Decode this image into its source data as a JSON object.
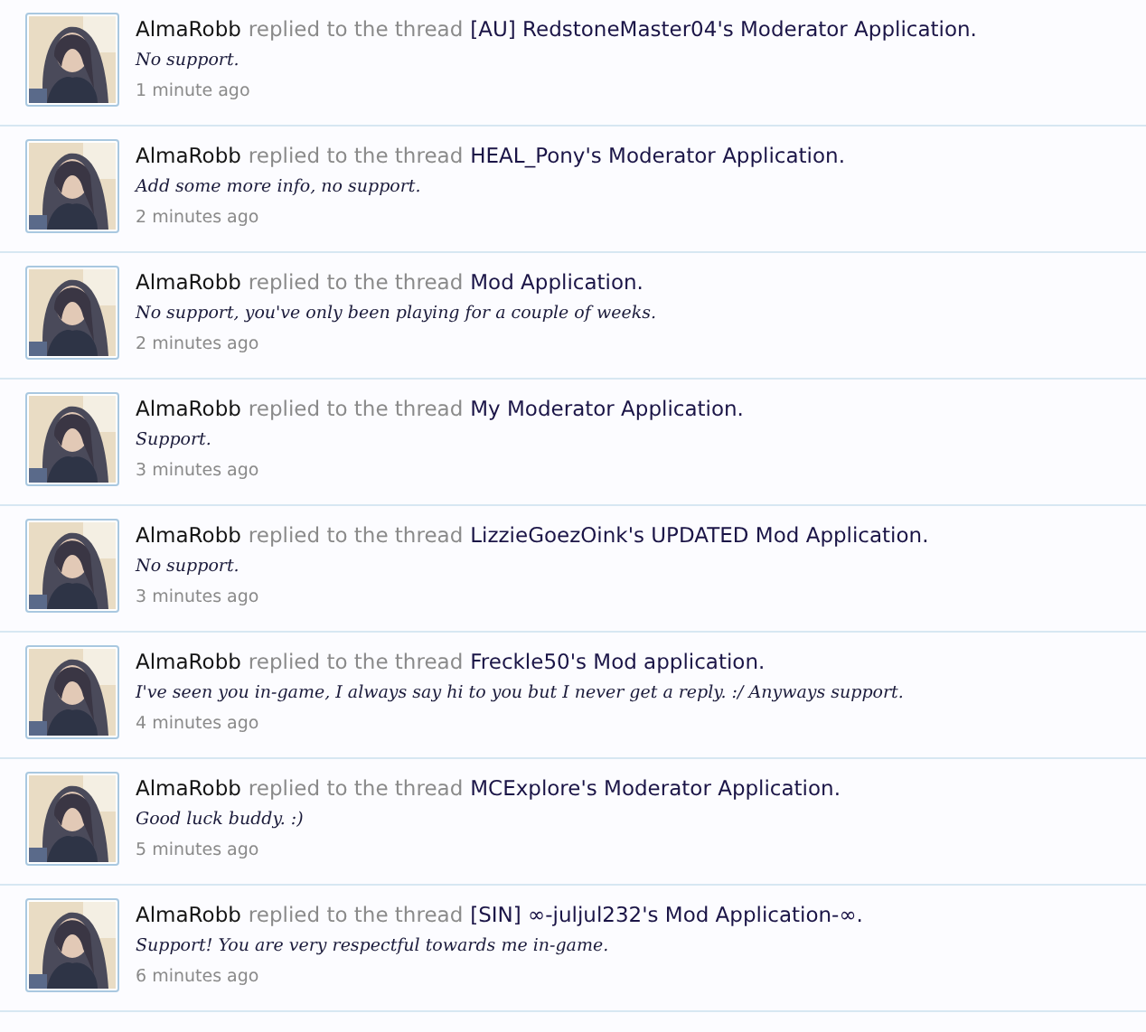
{
  "activity": [
    {
      "user": "AlmaRobb",
      "action": "replied to the thread",
      "thread": "[AU] RedstoneMaster04's Moderator Application.",
      "comment": "No support.",
      "time": "1 minute ago"
    },
    {
      "user": "AlmaRobb",
      "action": "replied to the thread",
      "thread": "HEAL_Pony's Moderator Application.",
      "comment": "Add some more info, no support.",
      "time": "2 minutes ago"
    },
    {
      "user": "AlmaRobb",
      "action": "replied to the thread",
      "thread": "Mod Application.",
      "comment": "No support, you've only been playing for a couple of weeks.",
      "time": "2 minutes ago"
    },
    {
      "user": "AlmaRobb",
      "action": "replied to the thread",
      "thread": "My Moderator Application.",
      "comment": "Support.",
      "time": "3 minutes ago"
    },
    {
      "user": "AlmaRobb",
      "action": "replied to the thread",
      "thread": "LizzieGoezOink's UPDATED Mod Application.",
      "comment": "No support.",
      "time": "3 minutes ago"
    },
    {
      "user": "AlmaRobb",
      "action": "replied to the thread",
      "thread": "Freckle50's Mod application.",
      "comment": "I've seen you in-game, I always say hi to you but I never get a reply. :/ Anyways support.",
      "time": "4 minutes ago"
    },
    {
      "user": "AlmaRobb",
      "action": "replied to the thread",
      "thread": "MCExplore's Moderator Application.",
      "comment": "Good luck buddy. :)",
      "time": "5 minutes ago"
    },
    {
      "user": "AlmaRobb",
      "action": "replied to the thread",
      "thread": "[SIN] ∞-juljul232's Mod Application-∞.",
      "comment": "Support! You are very respectful towards me in-game.",
      "time": "6 minutes ago"
    }
  ]
}
